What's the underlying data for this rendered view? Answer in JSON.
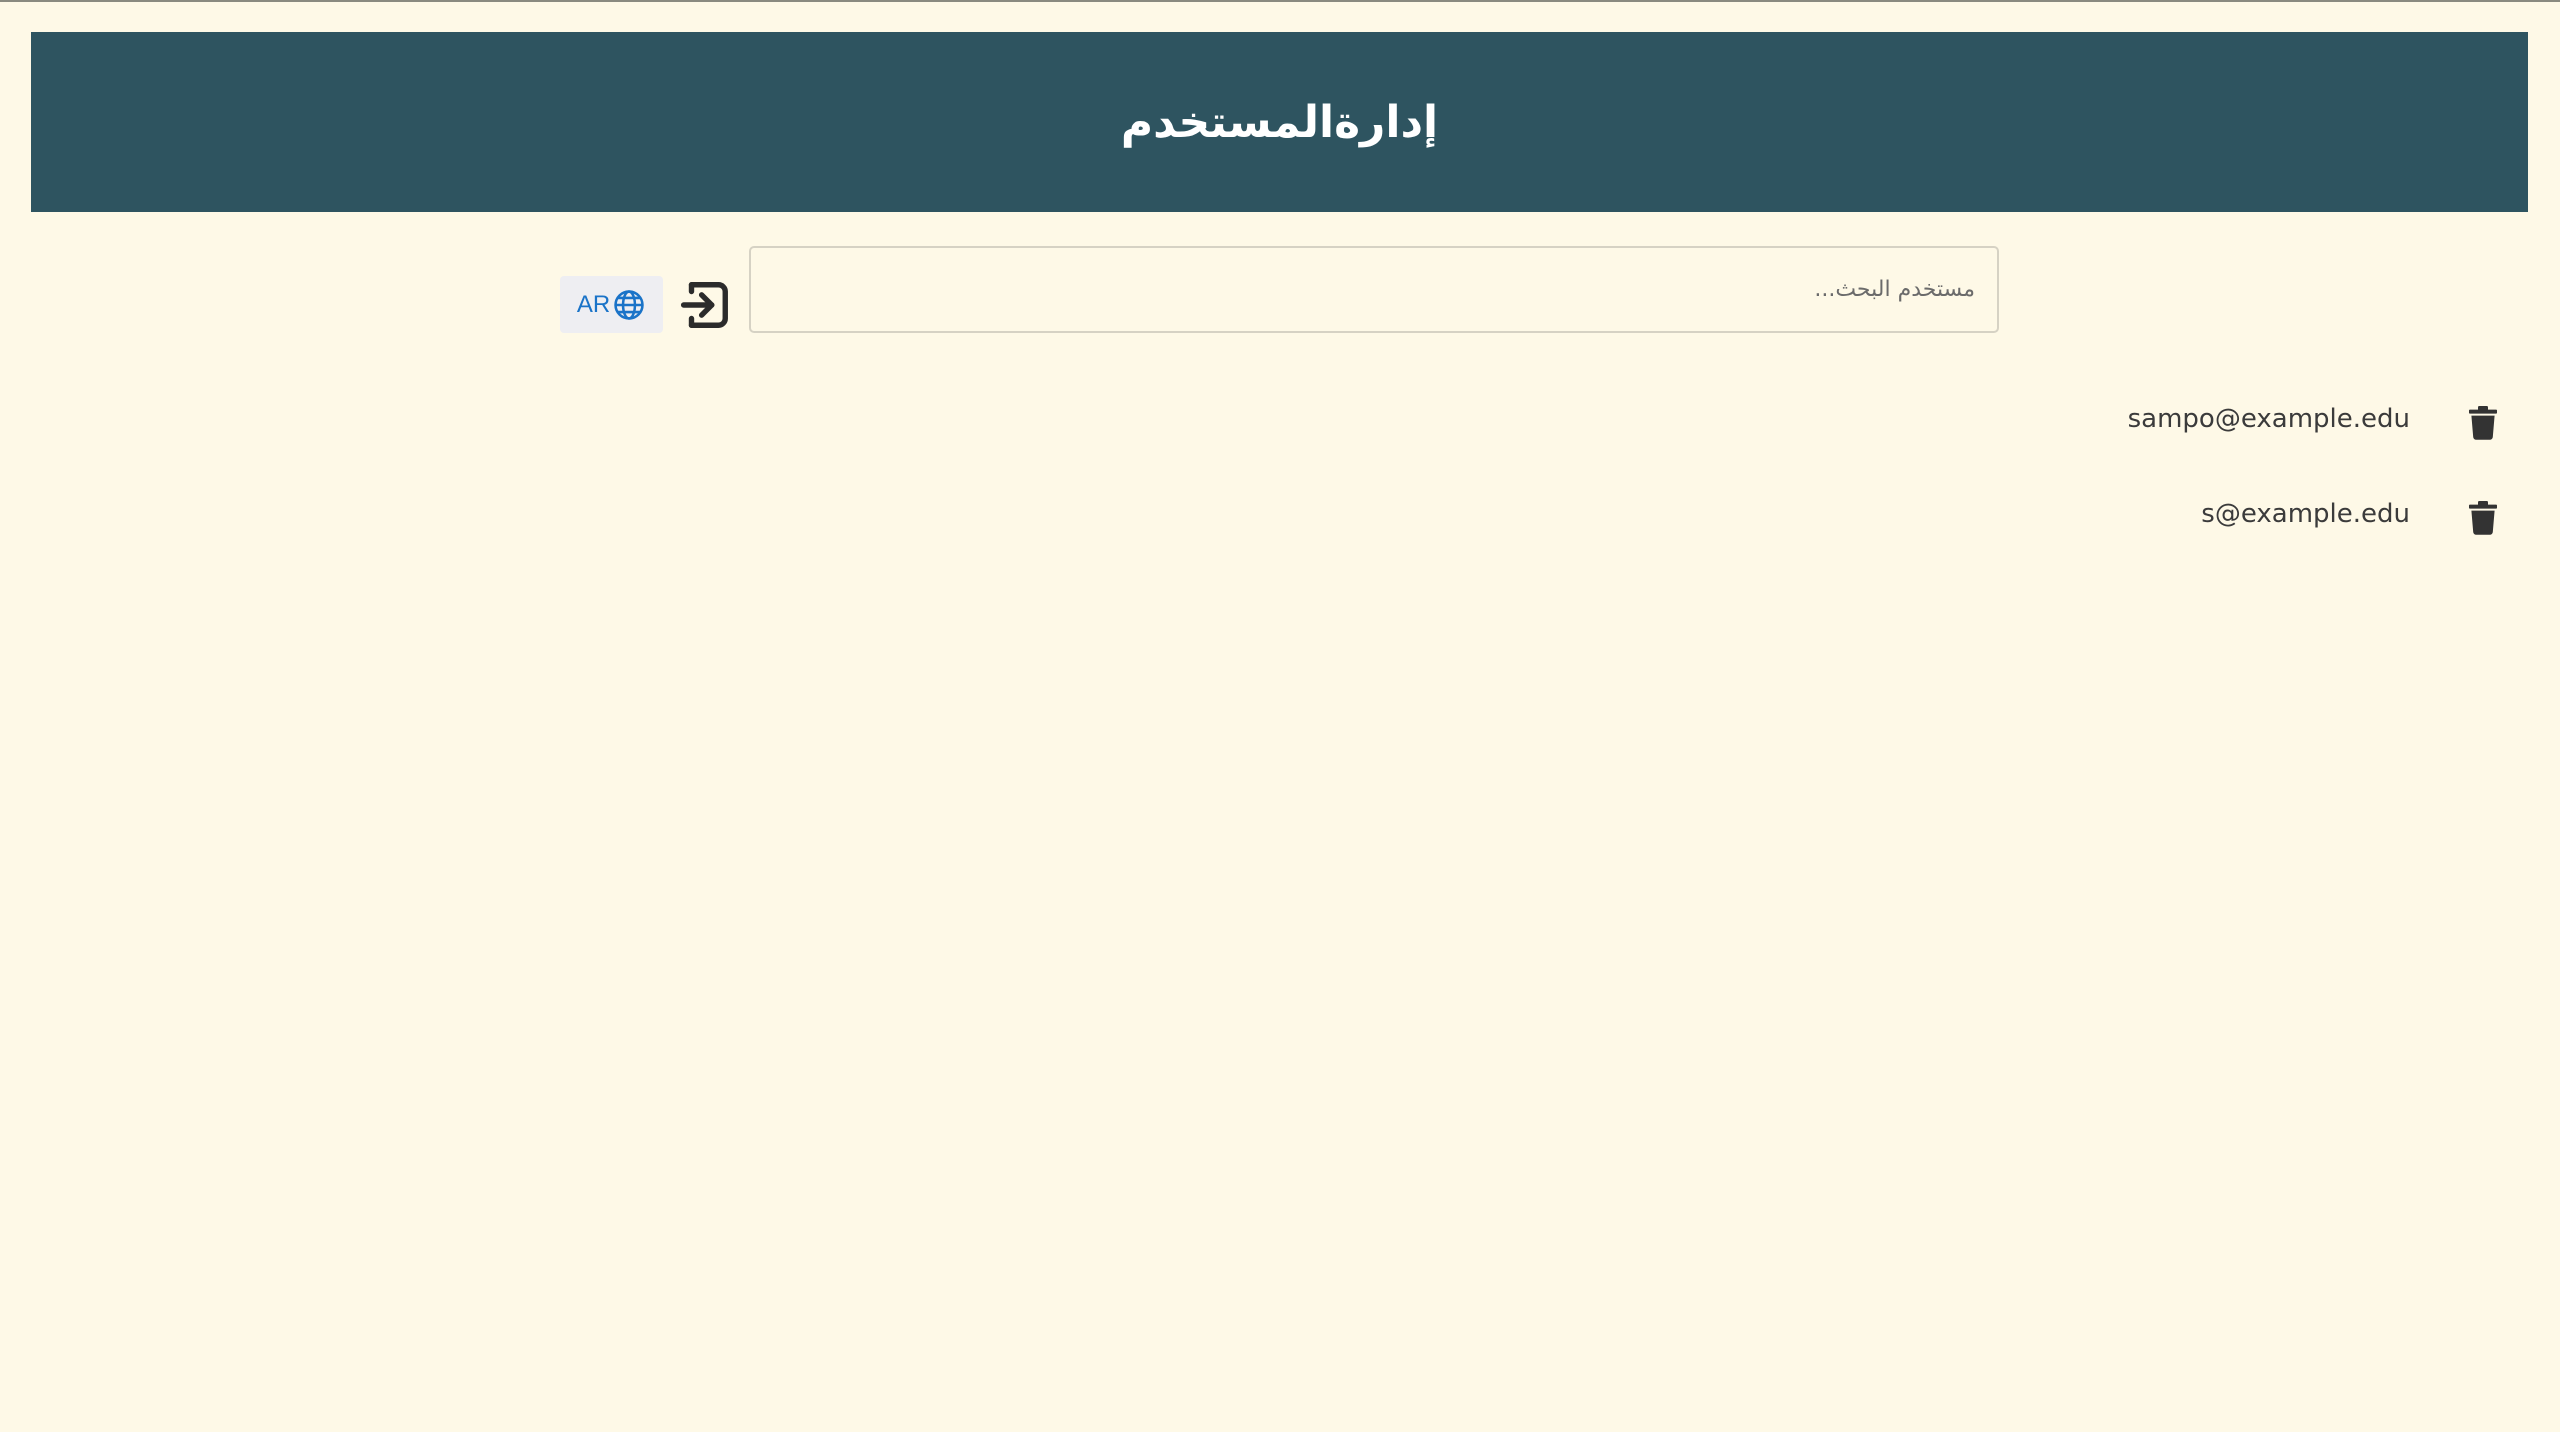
{
  "header": {
    "title": "إدارةالمستخدم"
  },
  "toolbar": {
    "language_label": "AR",
    "language_icon": "globe-icon",
    "logout_icon": "logout-icon",
    "search": {
      "placeholder": "مستخدم البحث...",
      "value": ""
    }
  },
  "users": [
    {
      "email": "sampo@example.edu",
      "delete_icon": "trash-icon"
    },
    {
      "email": "s@example.edu",
      "delete_icon": "trash-icon"
    }
  ],
  "colors": {
    "page_background": "#fef9e7",
    "header_background": "#2e5460",
    "header_text": "#ffffff",
    "language_text": "#1a73c8",
    "language_background": "#eeeef2",
    "icon_dark": "#333333"
  }
}
